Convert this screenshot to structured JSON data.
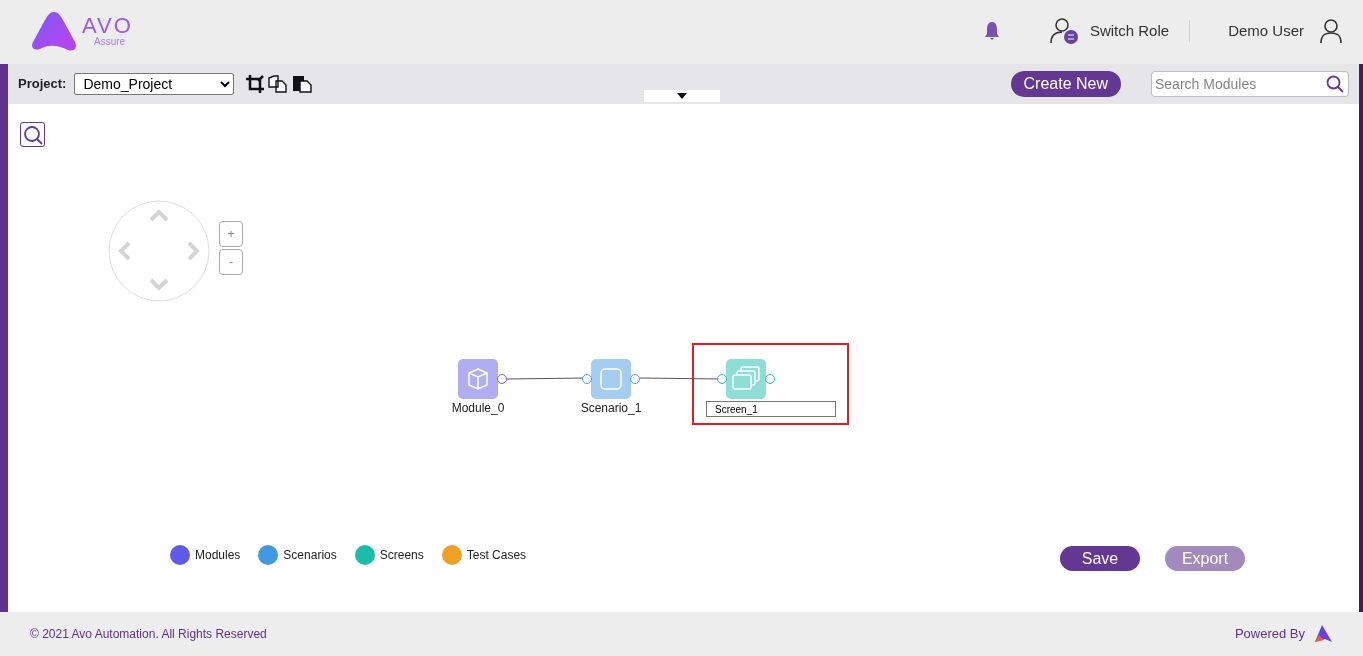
{
  "header": {
    "logo_word": "AVO",
    "logo_sub": "Assure",
    "switch_role": "Switch Role",
    "user": "Demo User"
  },
  "toolbar": {
    "project_label": "Project:",
    "project_value": "Demo_Project",
    "create_new": "Create New",
    "search": {
      "placeholder": "Search Modules"
    }
  },
  "nodes": [
    {
      "kind": "module",
      "label": "Module_0",
      "editing": false
    },
    {
      "kind": "scenario",
      "label": "Scenario_1",
      "editing": false
    },
    {
      "kind": "screen",
      "label": "Screen_1",
      "editing": true,
      "selected": true
    }
  ],
  "zoom_controls": [
    "+",
    "-"
  ],
  "legend": [
    {
      "label": "Modules",
      "color": "#5f5be6"
    },
    {
      "label": "Scenarios",
      "color": "#4398e2"
    },
    {
      "label": "Screens",
      "color": "#1bbcad"
    },
    {
      "label": "Test Cases",
      "color": "#f0a027"
    }
  ],
  "actions": [
    {
      "label": "Save",
      "disabled": false
    },
    {
      "label": "Export",
      "disabled": true
    }
  ],
  "footer": {
    "copyright": "© 2021 Avo Automation. All Rights Reserved",
    "powered_by": "Powered By"
  }
}
